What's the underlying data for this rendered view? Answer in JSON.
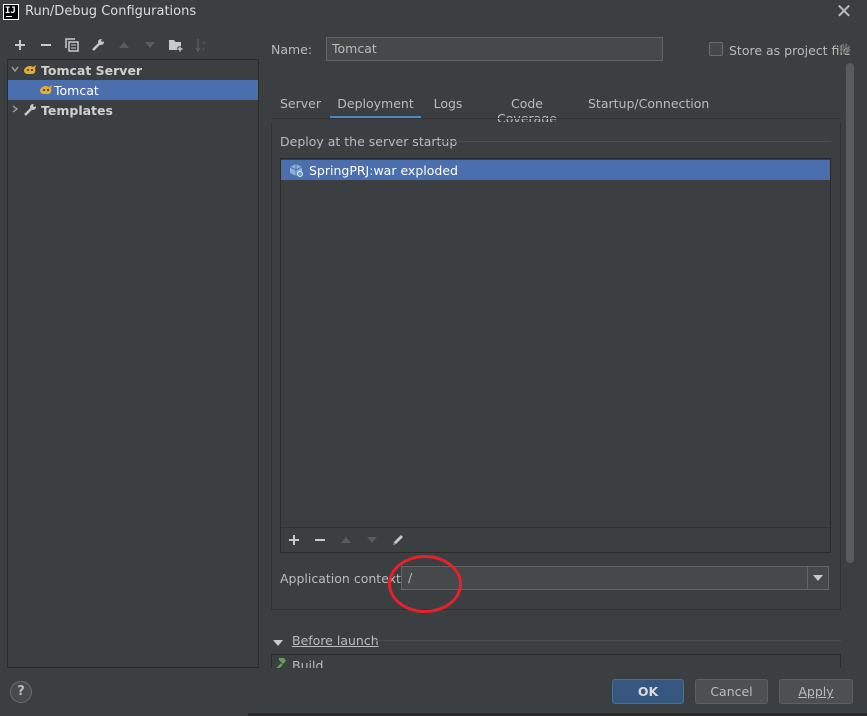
{
  "window": {
    "title": "Run/Debug Configurations",
    "app_icon_text": "IJ"
  },
  "toolbar": {
    "icons": [
      "add-icon",
      "remove-icon",
      "copy-icon",
      "wrench-icon",
      "move-up-icon",
      "move-down-icon",
      "new-folder-icon",
      "sort-icon"
    ]
  },
  "tree": {
    "items": [
      {
        "label": "Tomcat Server",
        "expanded": true,
        "level": 0,
        "bold": true
      },
      {
        "label": "Tomcat",
        "level": 1,
        "selected": true
      },
      {
        "label": "Templates",
        "expanded": false,
        "level": 0,
        "bold": true
      }
    ]
  },
  "form": {
    "name_label": "Name:",
    "name_value": "Tomcat",
    "store_label": "Store as project file",
    "store_checked": false
  },
  "tabs": [
    "Server",
    "Deployment",
    "Logs",
    "Code Coverage",
    "Startup/Connection"
  ],
  "active_tab": "Deployment",
  "deployment": {
    "group_title": "Deploy at the server startup",
    "artifacts": [
      "SpringPRJ:war exploded"
    ],
    "app_context_label": "Application context:",
    "app_context_value": "/"
  },
  "before_launch": {
    "title": "Before launch",
    "items": [
      "Build"
    ]
  },
  "buttons": {
    "help": "?",
    "ok": "OK",
    "cancel": "Cancel",
    "apply": "Apply"
  },
  "colors": {
    "background": "#3c3f41",
    "selection": "#4b6eaf",
    "ok_button": "#365880",
    "annotation": "#e8202a"
  }
}
